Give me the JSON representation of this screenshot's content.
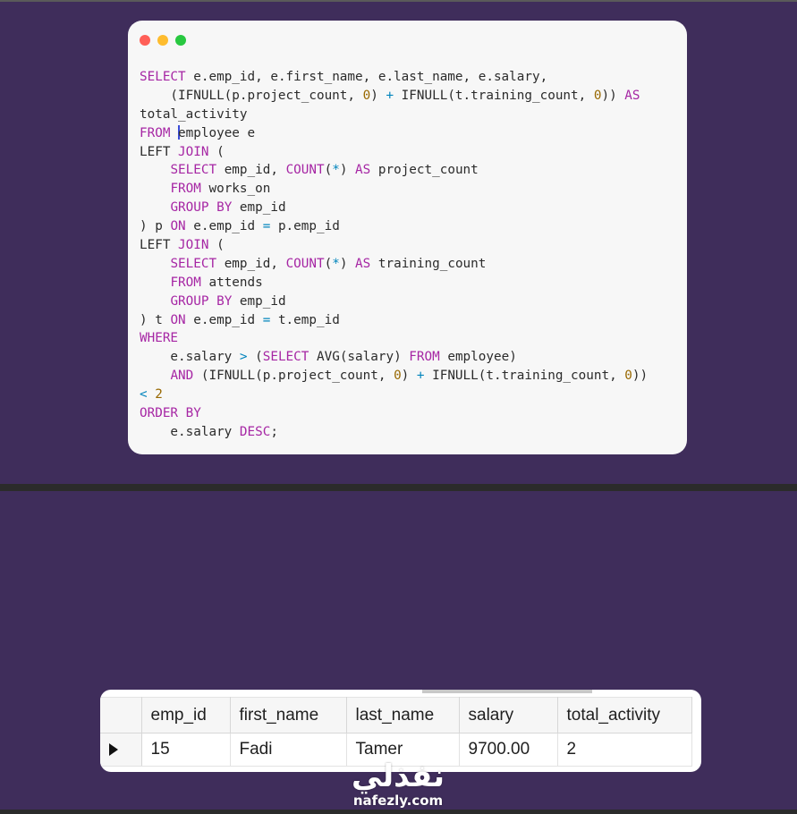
{
  "colors": {
    "background": "#3f2d5b",
    "code_window_bg": "#f7f7f7",
    "keyword": "#a626a4",
    "operator": "#0184bc",
    "number": "#986801",
    "text": "#2b2b2b"
  },
  "window_controls": {
    "close_icon": "red-dot-icon",
    "minimize_icon": "yellow-dot-icon",
    "maximize_icon": "green-dot-icon"
  },
  "code": {
    "lines": [
      [
        {
          "t": "SELECT",
          "c": "kw"
        },
        {
          "t": " e.emp_id, e.first_name, e.last_name, e.salary,"
        }
      ],
      [
        {
          "t": "    (IFNULL(p.project_count, "
        },
        {
          "t": "0",
          "c": "num"
        },
        {
          "t": ") "
        },
        {
          "t": "+",
          "c": "op"
        },
        {
          "t": " IFNULL(t.training_count, "
        },
        {
          "t": "0",
          "c": "num"
        },
        {
          "t": ")) "
        },
        {
          "t": "AS",
          "c": "kw"
        }
      ],
      [
        {
          "t": "total_activity"
        }
      ],
      [
        {
          "t": "FROM",
          "c": "kw"
        },
        {
          "t": " "
        },
        {
          "caret": true
        },
        {
          "t": "employee e"
        }
      ],
      [
        {
          "t": "LEFT "
        },
        {
          "t": "JOIN",
          "c": "kw"
        },
        {
          "t": " ("
        }
      ],
      [
        {
          "t": "    "
        },
        {
          "t": "SELECT",
          "c": "kw"
        },
        {
          "t": " emp_id, "
        },
        {
          "t": "COUNT",
          "c": "kw"
        },
        {
          "t": "("
        },
        {
          "t": "*",
          "c": "op"
        },
        {
          "t": ") "
        },
        {
          "t": "AS",
          "c": "kw"
        },
        {
          "t": " project_count"
        }
      ],
      [
        {
          "t": "    "
        },
        {
          "t": "FROM",
          "c": "kw"
        },
        {
          "t": " works_on"
        }
      ],
      [
        {
          "t": "    "
        },
        {
          "t": "GROUP BY",
          "c": "kw"
        },
        {
          "t": " emp_id"
        }
      ],
      [
        {
          "t": ") p "
        },
        {
          "t": "ON",
          "c": "kw"
        },
        {
          "t": " e.emp_id "
        },
        {
          "t": "=",
          "c": "op"
        },
        {
          "t": " p.emp_id"
        }
      ],
      [
        {
          "t": "LEFT "
        },
        {
          "t": "JOIN",
          "c": "kw"
        },
        {
          "t": " ("
        }
      ],
      [
        {
          "t": "    "
        },
        {
          "t": "SELECT",
          "c": "kw"
        },
        {
          "t": " emp_id, "
        },
        {
          "t": "COUNT",
          "c": "kw"
        },
        {
          "t": "("
        },
        {
          "t": "*",
          "c": "op"
        },
        {
          "t": ") "
        },
        {
          "t": "AS",
          "c": "kw"
        },
        {
          "t": " training_count"
        }
      ],
      [
        {
          "t": "    "
        },
        {
          "t": "FROM",
          "c": "kw"
        },
        {
          "t": " attends"
        }
      ],
      [
        {
          "t": "    "
        },
        {
          "t": "GROUP BY",
          "c": "kw"
        },
        {
          "t": " emp_id"
        }
      ],
      [
        {
          "t": ") t "
        },
        {
          "t": "ON",
          "c": "kw"
        },
        {
          "t": " e.emp_id "
        },
        {
          "t": "=",
          "c": "op"
        },
        {
          "t": " t.emp_id"
        }
      ],
      [
        {
          "t": "WHERE",
          "c": "kw"
        }
      ],
      [
        {
          "t": "    e.salary "
        },
        {
          "t": ">",
          "c": "op"
        },
        {
          "t": " ("
        },
        {
          "t": "SELECT",
          "c": "kw"
        },
        {
          "t": " AVG(salary) "
        },
        {
          "t": "FROM",
          "c": "kw"
        },
        {
          "t": " employee)"
        }
      ],
      [
        {
          "t": "    "
        },
        {
          "t": "AND",
          "c": "kw"
        },
        {
          "t": " (IFNULL(p.project_count, "
        },
        {
          "t": "0",
          "c": "num"
        },
        {
          "t": ") "
        },
        {
          "t": "+",
          "c": "op"
        },
        {
          "t": " IFNULL(t.training_count, "
        },
        {
          "t": "0",
          "c": "num"
        },
        {
          "t": "))"
        }
      ],
      [
        {
          "t": "<",
          "c": "op"
        },
        {
          "t": " "
        },
        {
          "t": "2",
          "c": "num"
        }
      ],
      [
        {
          "t": "ORDER BY",
          "c": "kw"
        }
      ],
      [
        {
          "t": "    e.salary "
        },
        {
          "t": "DESC",
          "c": "kw"
        },
        {
          "t": ";"
        }
      ]
    ]
  },
  "result_grid": {
    "columns": [
      "emp_id",
      "first_name",
      "last_name",
      "salary",
      "total_activity"
    ],
    "rows": [
      [
        "15",
        "Fadi",
        "Tamer",
        "9700.00",
        "2"
      ]
    ],
    "current_row_icon": "row-pointer-icon"
  },
  "watermark": {
    "logo_text": "نفذلي",
    "domain": "nafezly.com"
  }
}
